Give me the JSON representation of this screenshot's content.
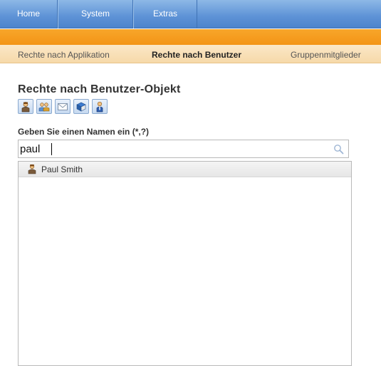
{
  "topnav": {
    "tabs": [
      {
        "label": "Home"
      },
      {
        "label": "System"
      },
      {
        "label": "Extras"
      }
    ]
  },
  "subnav": {
    "items": [
      {
        "label": "Rechte nach Applikation"
      },
      {
        "label": "Rechte nach Benutzer",
        "active": true
      },
      {
        "label": "Gruppenmitglieder"
      }
    ]
  },
  "page": {
    "title": "Rechte nach Benutzer-Objekt",
    "icons": [
      "user-icon",
      "group-icon",
      "mail-icon",
      "book-icon",
      "person-blue-icon"
    ]
  },
  "search": {
    "label": "Geben Sie einen Namen ein (*,?)",
    "value": "paul",
    "icon": "search-icon"
  },
  "results": [
    {
      "label": "Paul Smith",
      "icon": "user-icon"
    }
  ],
  "colors": {
    "topnav": "#5d92d6",
    "orange": "#f39416",
    "subnav": "#f6d9a9"
  }
}
